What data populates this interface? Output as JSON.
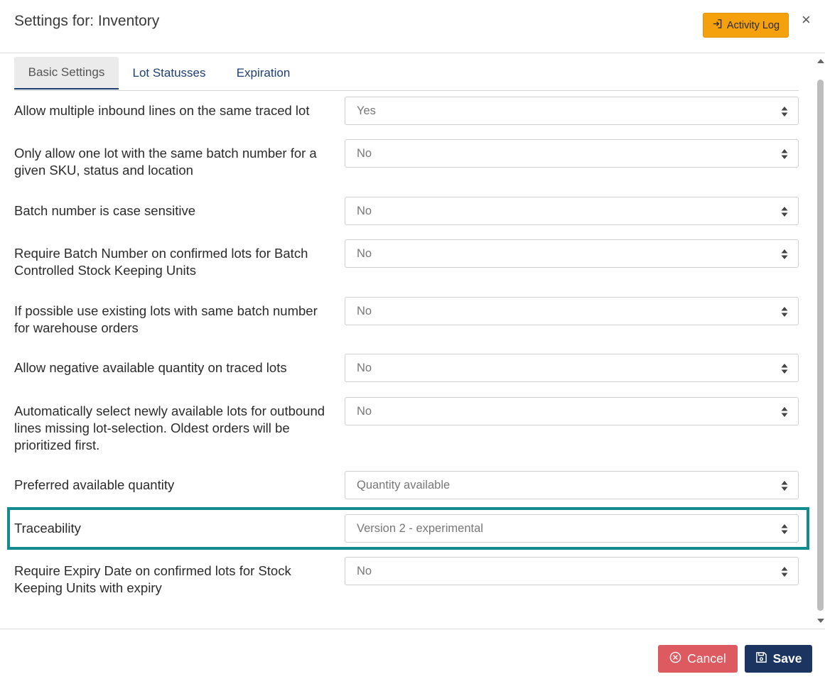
{
  "header": {
    "title": "Settings for: Inventory",
    "activity_log_label": "Activity Log",
    "activity_icon": "sign-in-icon",
    "close_label": "×"
  },
  "tabs": [
    {
      "label": "Basic Settings",
      "active": true
    },
    {
      "label": "Lot Statusses",
      "active": false
    },
    {
      "label": "Expiration",
      "active": false
    }
  ],
  "settings": [
    {
      "label": "Allow multiple inbound lines on the same traced lot",
      "value": "Yes"
    },
    {
      "label": "Only allow one lot with the same batch number for a given SKU, status and location",
      "value": "No"
    },
    {
      "label": "Batch number is case sensitive",
      "value": "No"
    },
    {
      "label": "Require Batch Number on confirmed lots for Batch Controlled Stock Keeping Units",
      "value": "No"
    },
    {
      "label": "If possible use existing lots with same batch number for warehouse orders",
      "value": "No"
    },
    {
      "label": "Allow negative available quantity on traced lots",
      "value": "No"
    },
    {
      "label": "Automatically select newly available lots for outbound lines missing lot-selection. Oldest orders will be prioritized first.",
      "value": "No"
    },
    {
      "label": "Preferred available quantity",
      "value": "Quantity available"
    },
    {
      "label": "Traceability",
      "value": "Version 2 - experimental"
    },
    {
      "label": "Require Expiry Date on confirmed lots for Stock Keeping Units with expiry",
      "value": "No"
    }
  ],
  "footer": {
    "cancel_label": "Cancel",
    "save_label": "Save"
  },
  "colors": {
    "accent_orange": "#f5a10e",
    "cancel_red": "#dc5a60",
    "save_navy": "#1b3560",
    "highlight_teal": "#128a8e",
    "tab_text": "#1d3f72"
  }
}
